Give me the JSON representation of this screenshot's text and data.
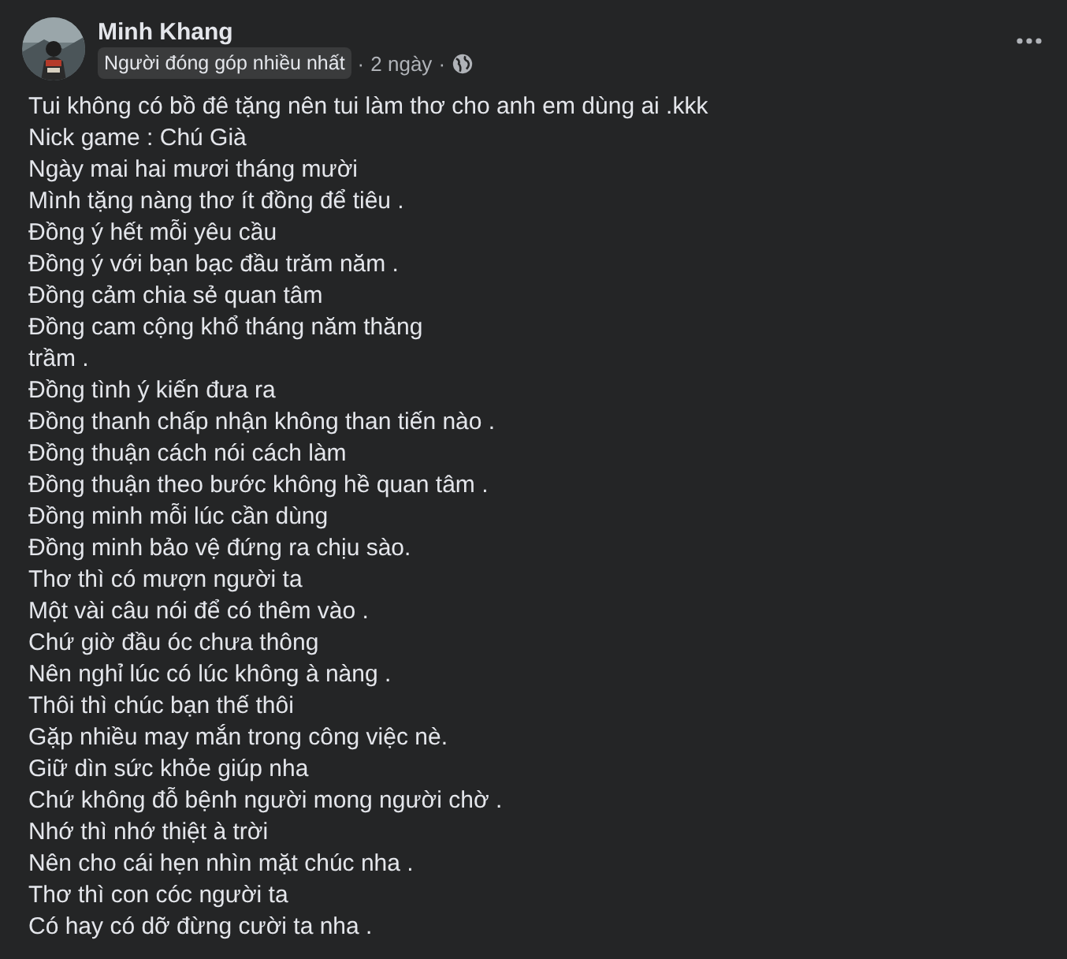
{
  "author": {
    "name": "Minh Khang",
    "badge": "Người đóng góp nhiều nhất",
    "time": "2 ngày",
    "separator": "·"
  },
  "post_lines": [
    "Tui không có bồ đê tặng nên tui làm thơ cho anh em dùng ai .kkk",
    "Nick game : Chú Già",
    "Ngày mai hai mươi tháng mười",
    "Mình tặng nàng thơ ít đồng để tiêu .",
    "Đồng ý hết mỗi yêu cầu",
    "Đồng ý với bạn bạc đầu trăm năm .",
    "Đồng cảm chia sẻ quan tâm",
    "Đồng cam cộng khổ tháng năm thăng",
    "trầm .",
    "Đồng tình ý kiến đưa ra",
    "Đồng thanh chấp nhận không than tiến nào .",
    "Đồng thuận cách nói cách làm",
    "Đồng thuận theo bước không hề quan tâm .",
    "Đồng minh mỗi lúc cần dùng",
    "Đồng minh bảo vệ đứng ra chịu sào.",
    "Thơ thì có mượn người ta",
    "Một vài câu nói để có thêm vào .",
    "Chứ giờ đầu óc chưa thông",
    "Nên nghỉ lúc có lúc không à nàng .",
    "Thôi thì chúc bạn thế thôi",
    "Gặp nhiều may mắn trong công việc nè.",
    "Giữ dìn sức khỏe giúp nha",
    "Chứ không đỗ bệnh người mong người chờ .",
    "Nhớ thì nhớ thiệt à trời",
    "Nên cho cái hẹn nhìn mặt chúc nha .",
    "Thơ thì con cóc người ta",
    "Có hay có dỡ đừng cười ta nha ."
  ]
}
